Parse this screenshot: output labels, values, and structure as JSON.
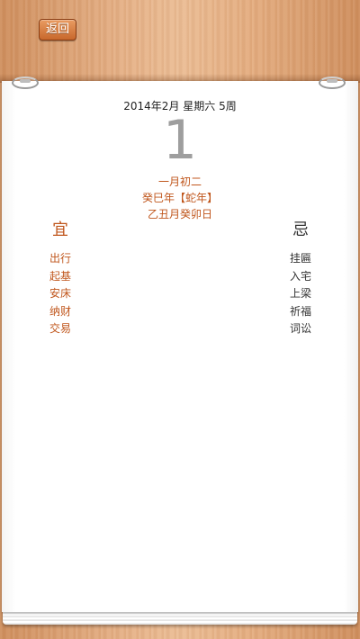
{
  "toolbar": {
    "back_label": "返回"
  },
  "date": {
    "header": "2014年2月 星期六 5周",
    "day": "1",
    "lunar_day": "一月初二",
    "lunar_year": "癸巳年【蛇年】",
    "ganzhi": "乙丑月癸卯日"
  },
  "yi": {
    "heading": "宜",
    "items": [
      "出行",
      "起基",
      "安床",
      "纳财",
      "交易"
    ]
  },
  "ji": {
    "heading": "忌",
    "items": [
      "挂匾",
      "入宅",
      "上梁",
      "祈福",
      "词讼"
    ]
  },
  "colors": {
    "accent": "#c0561c",
    "button": "#d07a3e",
    "day_number": "#9e9e9e"
  }
}
